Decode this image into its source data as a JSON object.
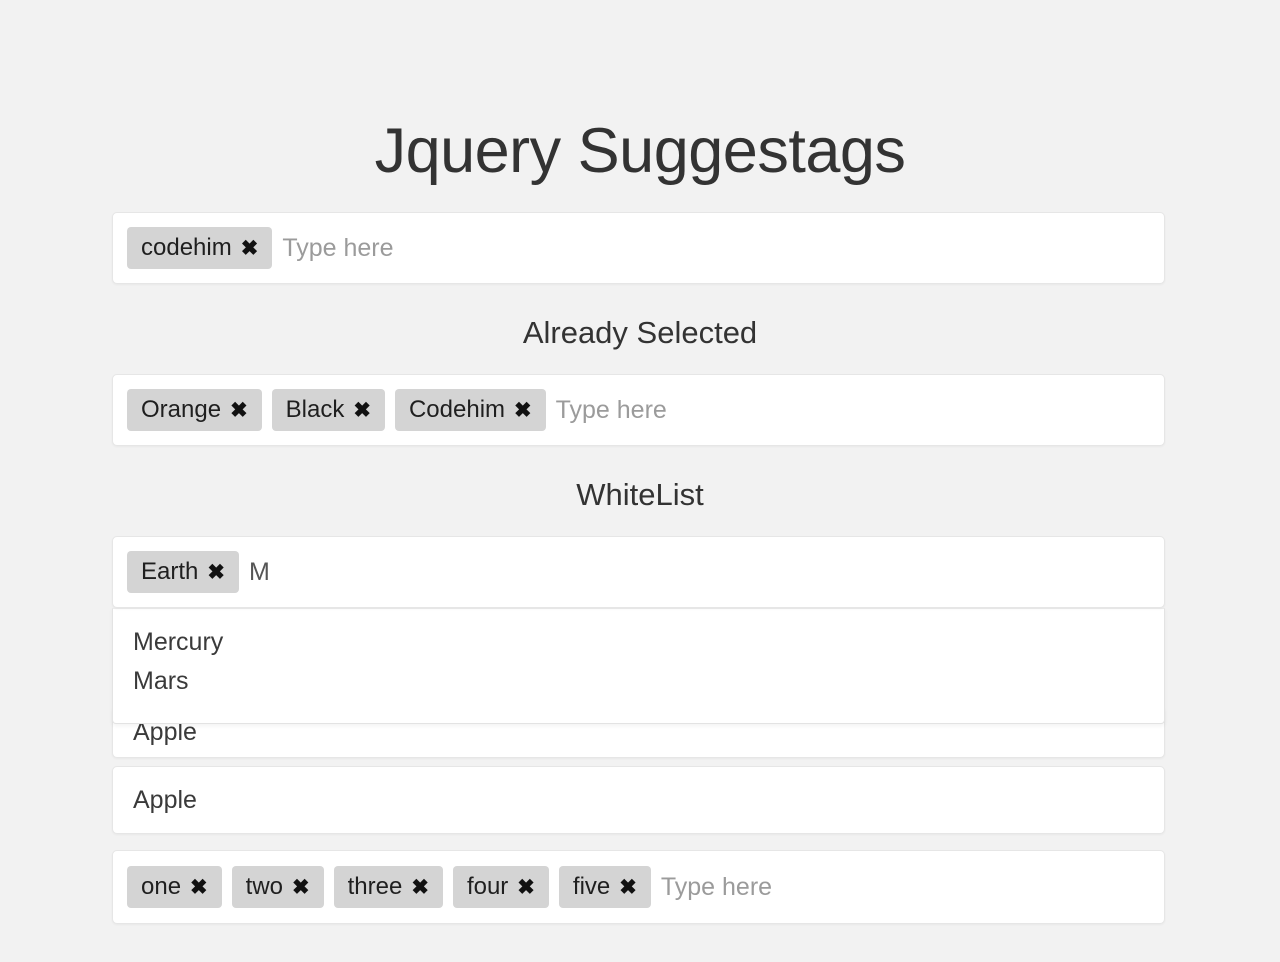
{
  "page": {
    "title": "Jquery Suggestags",
    "background_color": "#f2f2f2",
    "text_color": "#333333",
    "tag_background_color": "#d4d4d4",
    "placeholder_color": "#9b9b9b"
  },
  "sections": {
    "basic": {
      "tags": [
        {
          "label": "codehim",
          "remove_icon": "close-x-icon"
        }
      ],
      "input_value": "",
      "placeholder": "Type here"
    },
    "already_selected": {
      "heading": "Already Selected",
      "tags": [
        {
          "label": "Orange",
          "remove_icon": "close-x-icon"
        },
        {
          "label": "Black",
          "remove_icon": "close-x-icon"
        },
        {
          "label": "Codehim",
          "remove_icon": "close-x-icon"
        }
      ],
      "input_value": "",
      "placeholder": "Type here"
    },
    "whitelist": {
      "heading": "WhiteList",
      "tags": [
        {
          "label": "Earth",
          "remove_icon": "close-x-icon"
        }
      ],
      "input_value": "M",
      "placeholder": "Type here",
      "suggestions": [
        {
          "label": "Mercury"
        },
        {
          "label": "Mars"
        }
      ]
    },
    "fruit_hidden": {
      "text": "Apple"
    },
    "fruit_visible": {
      "text": "Apple"
    },
    "numbers": {
      "tags": [
        {
          "label": "one",
          "remove_icon": "close-x-icon"
        },
        {
          "label": "two",
          "remove_icon": "close-x-icon"
        },
        {
          "label": "three",
          "remove_icon": "close-x-icon"
        },
        {
          "label": "four",
          "remove_icon": "close-x-icon"
        },
        {
          "label": "five",
          "remove_icon": "close-x-icon"
        }
      ],
      "input_value": "",
      "placeholder": "Type here"
    }
  },
  "icons": {
    "remove": "✖"
  }
}
